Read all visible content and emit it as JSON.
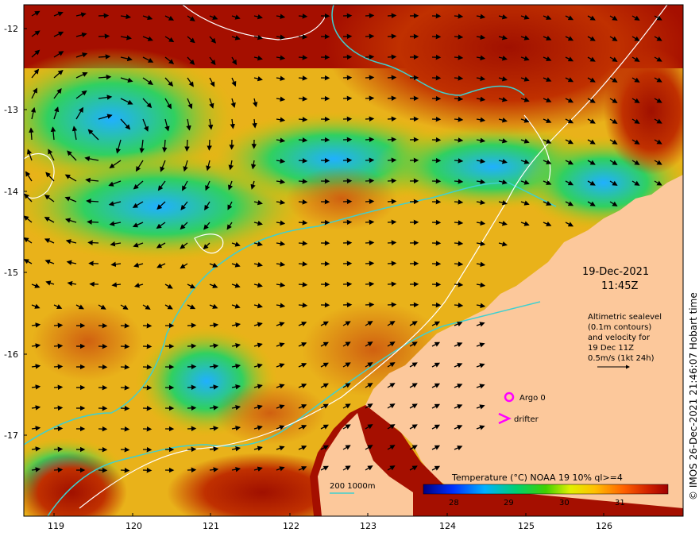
{
  "map": {
    "date": "19-Dec-2021",
    "time": "11:45Z",
    "altimetry_note": [
      "Altimetric sealevel",
      "(0.1m contours)",
      "and velocity for",
      "19 Dec 11Z",
      "0.5m/s (1kt 24h)"
    ],
    "legend_argo": "Argo 0",
    "legend_drifter": "drifter",
    "isobath_label": "200  1000m",
    "colorbar_title": "Temperature (°C) NOAA 19 10% ql>=4",
    "colorbar_ticks": [
      "28",
      "29",
      "30",
      "31"
    ],
    "copyright": "© IMOS 26-Dec-2021 21:46:07 Hobart time",
    "lon_ticks": [
      "119",
      "120",
      "121",
      "122",
      "123",
      "124",
      "125",
      "126"
    ],
    "lat_ticks": [
      "-12",
      "-13",
      "-14",
      "-15",
      "-16",
      "-17"
    ],
    "colors": {
      "land": "#fcc89b",
      "warm": "#a50f00",
      "isobath": "#3fd0d0",
      "contour": "#ffffff",
      "argo": "#ff00ff"
    }
  }
}
